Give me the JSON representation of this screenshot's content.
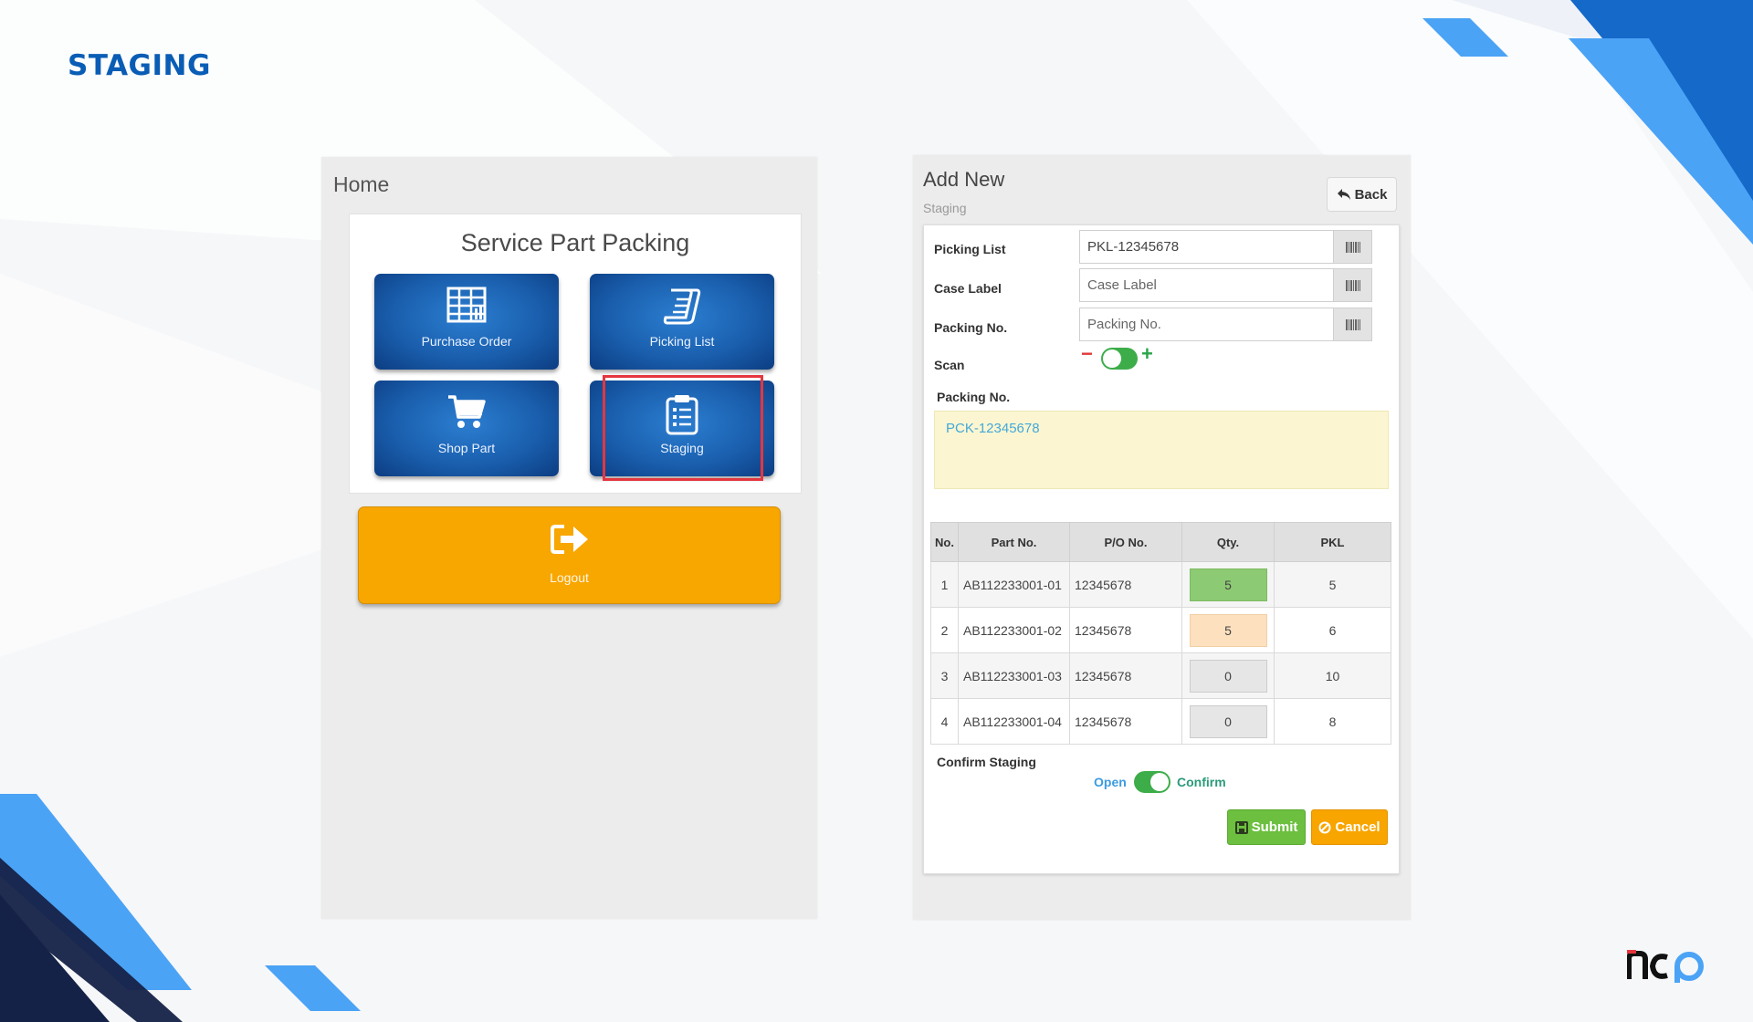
{
  "slide": {
    "title": "STAGING",
    "logo_text": "ncp",
    "colors": {
      "brand_blue": "#0a5db5",
      "accent_light_blue": "#4ba3f5",
      "navy": "#152247"
    }
  },
  "home": {
    "heading": "Home",
    "card_title": "Service Part Packing",
    "tiles": [
      {
        "label": "Purchase Order",
        "icon": "table-chart-icon"
      },
      {
        "label": "Picking List",
        "icon": "scroll-list-icon"
      },
      {
        "label": "Shop Part",
        "icon": "shopping-cart-icon"
      },
      {
        "label": "Staging",
        "icon": "clipboard-list-icon",
        "highlighted": true
      }
    ],
    "logout_label": "Logout"
  },
  "add_new": {
    "title": "Add New",
    "subtitle": "Staging",
    "back_label": "Back",
    "fields": {
      "picking_list": {
        "label": "Picking List",
        "value": "PKL-12345678",
        "placeholder": ""
      },
      "case_label": {
        "label": "Case Label",
        "value": "",
        "placeholder": "Case Label"
      },
      "packing_no": {
        "label": "Packing No.",
        "value": "",
        "placeholder": "Packing No."
      }
    },
    "scan": {
      "label": "Scan",
      "minus": "−",
      "plus": "+",
      "on": true
    },
    "packing_list": {
      "label": "Packing No.",
      "value": "PCK-12345678"
    },
    "table": {
      "headers": [
        "No.",
        "Part No.",
        "P/O No.",
        "Qty.",
        "PKL"
      ],
      "rows": [
        {
          "no": "1",
          "part": "AB112233001-01",
          "po": "12345678",
          "qty": "5",
          "pkl": "5",
          "qty_status": "complete"
        },
        {
          "no": "2",
          "part": "AB112233001-02",
          "po": "12345678",
          "qty": "5",
          "pkl": "6",
          "qty_status": "partial"
        },
        {
          "no": "3",
          "part": "AB112233001-03",
          "po": "12345678",
          "qty": "0",
          "pkl": "10",
          "qty_status": "none"
        },
        {
          "no": "4",
          "part": "AB112233001-04",
          "po": "12345678",
          "qty": "0",
          "pkl": "8",
          "qty_status": "none"
        }
      ]
    },
    "confirm_staging": {
      "label": "Confirm Staging",
      "open_label": "Open",
      "confirm_label": "Confirm",
      "state": "Confirm"
    },
    "buttons": {
      "submit": "Submit",
      "cancel": "Cancel"
    }
  }
}
